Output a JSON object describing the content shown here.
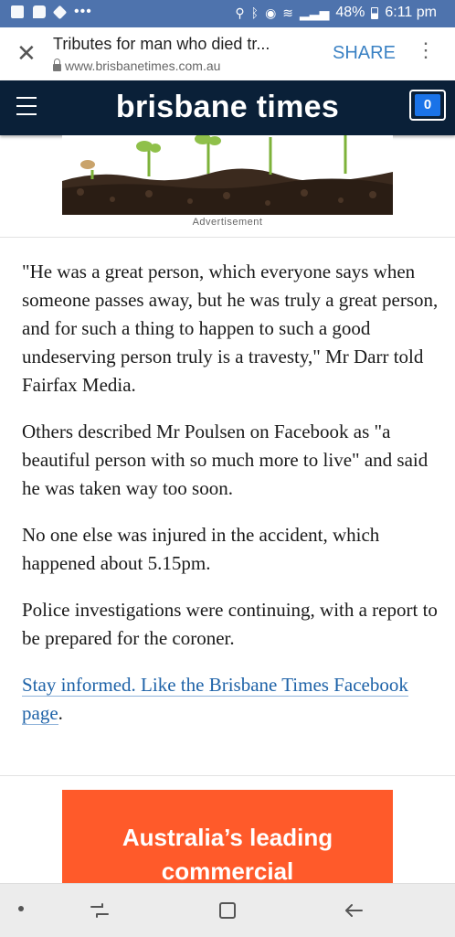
{
  "status_bar": {
    "battery": "48%",
    "time": "6:11 pm",
    "icons": [
      "outlook-icon",
      "message-icon",
      "diamond-icon",
      "location-icon",
      "bluetooth-icon",
      "alarm-icon",
      "wifi-icon",
      "signal-icon",
      "battery-icon"
    ]
  },
  "browser": {
    "page_title": "Tributes for man who died tr...",
    "domain": "www.brisbanetimes.com.au",
    "share_label": "SHARE",
    "close_symbol": "✕",
    "menu_symbol": "⋮"
  },
  "site": {
    "brand": "brisbane times",
    "notification_count": "0",
    "brand_color": "#0a2038",
    "count_color": "#1a73e8"
  },
  "ad": {
    "label": "Advertisement"
  },
  "article": {
    "paragraphs": [
      "\"He was a great person, which everyone says when someone passes away, but he was truly a great person, and for such a thing to happen to such a good undeserving person truly is a travesty,\" Mr Darr told Fairfax Media.",
      "Others described Mr Poulsen on Facebook as \"a beautiful person with so much more to live\" and said he was taken way too soon.",
      "No one else was injured in the accident, which happened about 5.15pm.",
      "Police investigations were continuing, with a report to be prepared for the coroner."
    ],
    "cta_link": "Stay informed. Like the Brisbane Times Facebook page",
    "cta_suffix": "."
  },
  "banner": {
    "text_line1": "Australia’s leading",
    "text_line2": "commercial",
    "bg_color": "#ff5a2a"
  },
  "navbar": {
    "buttons": [
      "dot-icon",
      "recents-icon",
      "home-icon",
      "back-icon"
    ]
  }
}
